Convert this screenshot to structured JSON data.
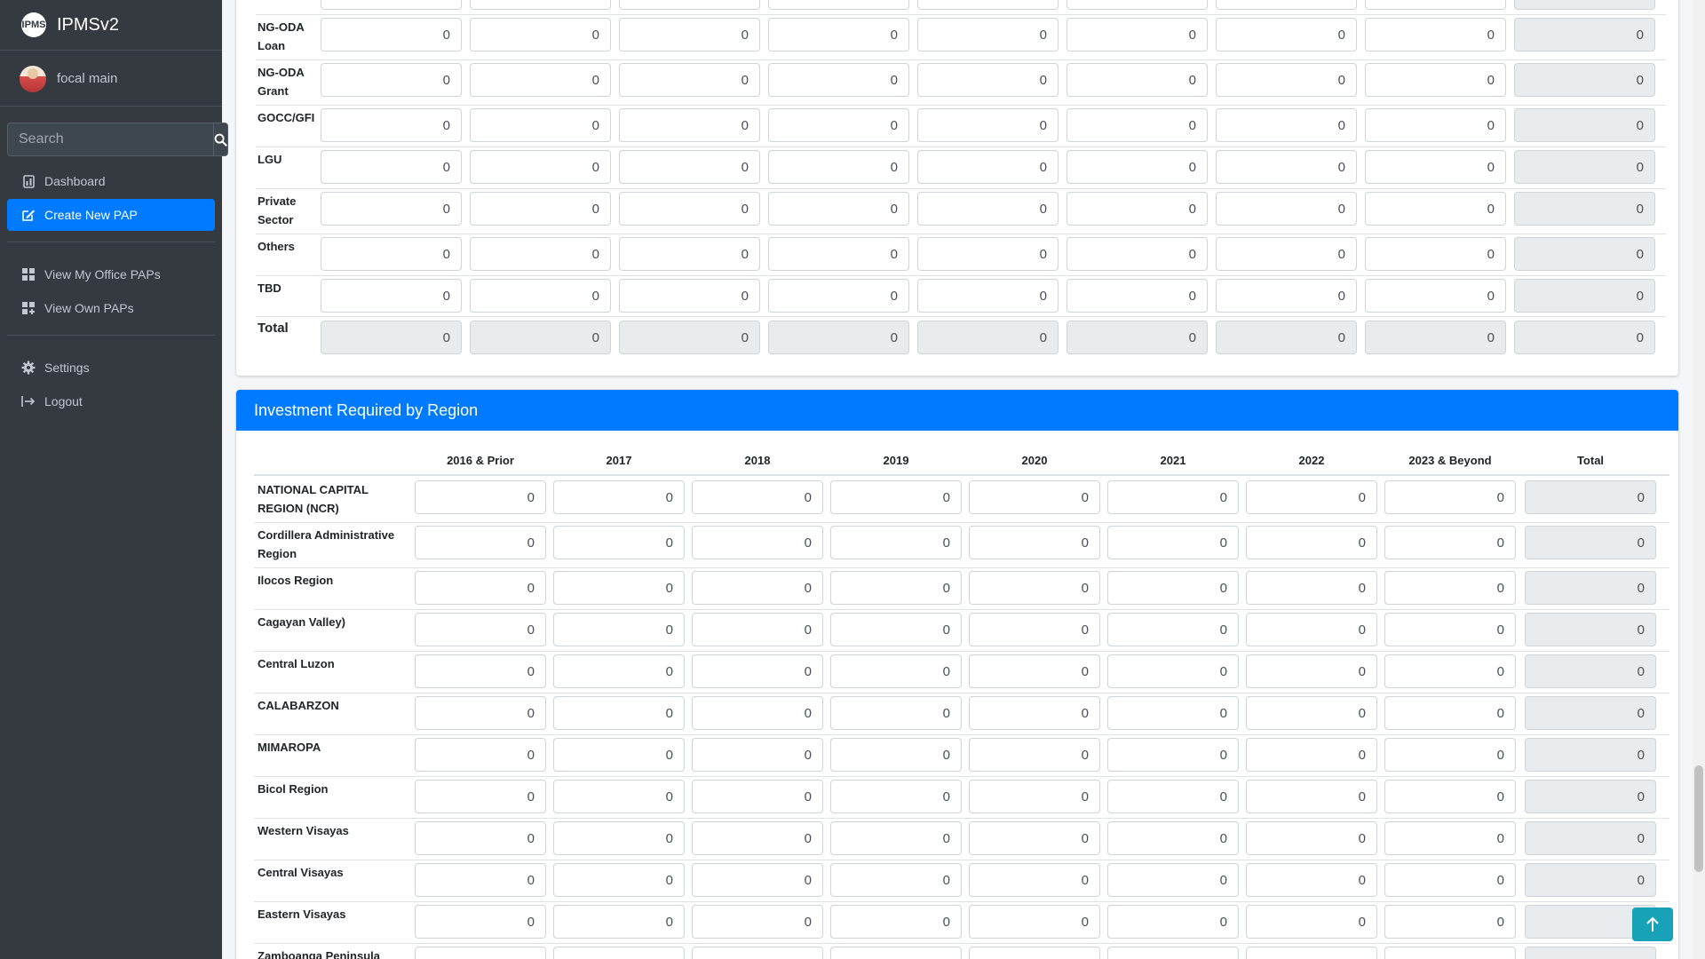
{
  "app": {
    "logo_text": "IPMS",
    "title": "IPMSv2"
  },
  "user": {
    "name": "focal main"
  },
  "search": {
    "placeholder": "Search"
  },
  "nav": {
    "dashboard": "Dashboard",
    "create_pap": "Create New PAP",
    "view_office": "View My Office PAPs",
    "view_own": "View Own PAPs",
    "settings": "Settings",
    "logout": "Logout"
  },
  "funding": {
    "rows": [
      {
        "label": "NG-ODA Loan",
        "values": [
          "0",
          "0",
          "0",
          "0",
          "0",
          "0",
          "0",
          "0"
        ],
        "total": "0"
      },
      {
        "label": "NG-ODA Grant",
        "values": [
          "0",
          "0",
          "0",
          "0",
          "0",
          "0",
          "0",
          "0"
        ],
        "total": "0"
      },
      {
        "label": "GOCC/GFI",
        "values": [
          "0",
          "0",
          "0",
          "0",
          "0",
          "0",
          "0",
          "0"
        ],
        "total": "0"
      },
      {
        "label": "LGU",
        "values": [
          "0",
          "0",
          "0",
          "0",
          "0",
          "0",
          "0",
          "0"
        ],
        "total": "0"
      },
      {
        "label": "Private Sector",
        "values": [
          "0",
          "0",
          "0",
          "0",
          "0",
          "0",
          "0",
          "0"
        ],
        "total": "0"
      },
      {
        "label": "Others",
        "values": [
          "0",
          "0",
          "0",
          "0",
          "0",
          "0",
          "0",
          "0"
        ],
        "total": "0"
      },
      {
        "label": "TBD",
        "values": [
          "0",
          "0",
          "0",
          "0",
          "0",
          "0",
          "0",
          "0"
        ],
        "total": "0"
      }
    ],
    "total_row": {
      "label": "Total",
      "values": [
        "0",
        "0",
        "0",
        "0",
        "0",
        "0",
        "0",
        "0"
      ],
      "total": "0"
    }
  },
  "region": {
    "title": "Investment Required by Region",
    "columns": [
      "2016 & Prior",
      "2017",
      "2018",
      "2019",
      "2020",
      "2021",
      "2022",
      "2023 & Beyond",
      "Total"
    ],
    "rows": [
      {
        "label": "NATIONAL CAPITAL REGION (NCR)",
        "values": [
          "0",
          "0",
          "0",
          "0",
          "0",
          "0",
          "0",
          "0"
        ],
        "total": "0"
      },
      {
        "label": "Cordillera Administrative Region",
        "values": [
          "0",
          "0",
          "0",
          "0",
          "0",
          "0",
          "0",
          "0"
        ],
        "total": "0"
      },
      {
        "label": "Ilocos Region",
        "values": [
          "0",
          "0",
          "0",
          "0",
          "0",
          "0",
          "0",
          "0"
        ],
        "total": "0"
      },
      {
        "label": "Cagayan Valley)",
        "values": [
          "0",
          "0",
          "0",
          "0",
          "0",
          "0",
          "0",
          "0"
        ],
        "total": "0"
      },
      {
        "label": "Central Luzon",
        "values": [
          "0",
          "0",
          "0",
          "0",
          "0",
          "0",
          "0",
          "0"
        ],
        "total": "0"
      },
      {
        "label": "CALABARZON",
        "values": [
          "0",
          "0",
          "0",
          "0",
          "0",
          "0",
          "0",
          "0"
        ],
        "total": "0"
      },
      {
        "label": "MIMAROPA",
        "values": [
          "0",
          "0",
          "0",
          "0",
          "0",
          "0",
          "0",
          "0"
        ],
        "total": "0"
      },
      {
        "label": "Bicol Region",
        "values": [
          "0",
          "0",
          "0",
          "0",
          "0",
          "0",
          "0",
          "0"
        ],
        "total": "0"
      },
      {
        "label": "Western Visayas",
        "values": [
          "0",
          "0",
          "0",
          "0",
          "0",
          "0",
          "0",
          "0"
        ],
        "total": "0"
      },
      {
        "label": "Central Visayas",
        "values": [
          "0",
          "0",
          "0",
          "0",
          "0",
          "0",
          "0",
          "0"
        ],
        "total": "0"
      },
      {
        "label": "Eastern Visayas",
        "values": [
          "0",
          "0",
          "0",
          "0",
          "0",
          "0",
          "0",
          "0"
        ],
        "total": ""
      },
      {
        "label": "Zamboanga Peninsula",
        "values": [
          "",
          "",
          "",
          "",
          "",
          "",
          "",
          ""
        ],
        "total": ""
      }
    ]
  },
  "colors": {
    "primary": "#007bff",
    "sidebar": "#343a40",
    "scroll_top": "#17a2b8"
  },
  "icons": {
    "search": "search-icon",
    "dashboard": "dashboard-icon",
    "create": "edit-icon",
    "view": "grid-icon",
    "settings": "gear-icon",
    "logout": "logout-icon",
    "scroll_top": "arrow-up-icon"
  }
}
